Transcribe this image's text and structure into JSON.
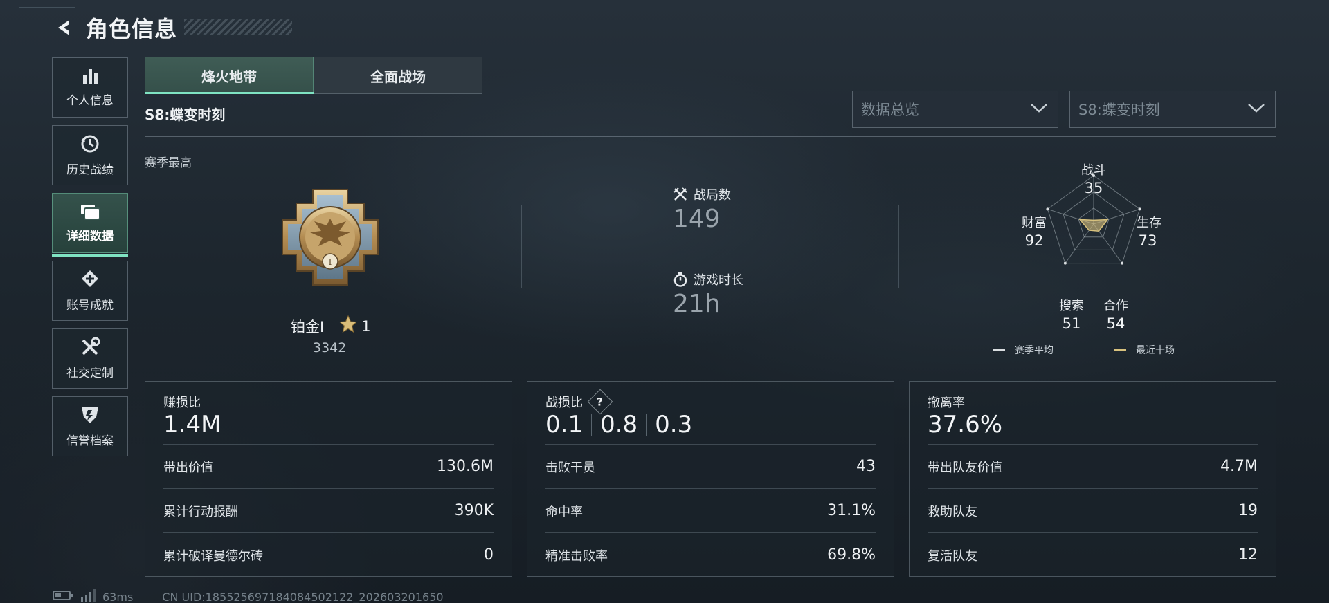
{
  "header": {
    "title": "角色信息"
  },
  "sidebar": {
    "items": [
      {
        "label": "个人信息",
        "icon": "bar-chart-icon"
      },
      {
        "label": "历史战绩",
        "icon": "history-clock-icon"
      },
      {
        "label": "详细数据",
        "icon": "folders-icon",
        "active": true
      },
      {
        "label": "账号成就",
        "icon": "achievement-icon"
      },
      {
        "label": "社交定制",
        "icon": "tools-icon"
      },
      {
        "label": "信誉档案",
        "icon": "credit-shield-icon"
      }
    ]
  },
  "tabs": [
    {
      "label": "烽火地带",
      "active": true
    },
    {
      "label": "全面战场",
      "active": false
    }
  ],
  "season": {
    "label": "S8:蝶变时刻"
  },
  "filters": {
    "category": "数据总览",
    "season": "S8:蝶变时刻"
  },
  "overview": {
    "section_label": "赛季最高",
    "rank_name": "铂金Ⅰ",
    "rank_stars": "1",
    "rank_score": "3342",
    "matches_label": "战局数",
    "matches_value": "149",
    "playtime_label": "游戏时长",
    "playtime_value": "21h"
  },
  "radar": {
    "axes": [
      {
        "label": "战斗",
        "value": "35"
      },
      {
        "label": "生存",
        "value": "73"
      },
      {
        "label": "合作",
        "value": "54"
      },
      {
        "label": "搜索",
        "value": "51"
      },
      {
        "label": "财富",
        "value": "92"
      }
    ],
    "recent_shape": [
      0.08,
      0.3,
      0.18,
      0.16,
      0.3
    ],
    "legend": {
      "season_avg": "赛季平均",
      "recent_ten": "最近十场"
    },
    "colors": {
      "season_avg": "#d9dde0",
      "recent_ten": "#d8c27e"
    }
  },
  "cards": {
    "profit": {
      "title": "赚损比",
      "value": "1.4M",
      "rows": [
        {
          "label": "带出价值",
          "value": "130.6M"
        },
        {
          "label": "累计行动报酬",
          "value": "390K"
        },
        {
          "label": "累计破译曼德尔砖",
          "value": "0"
        }
      ]
    },
    "combat": {
      "title": "战损比",
      "values": [
        "0.1",
        "0.8",
        "0.3"
      ],
      "help": "?",
      "rows": [
        {
          "label": "击败干员",
          "value": "43"
        },
        {
          "label": "命中率",
          "value": "31.1%"
        },
        {
          "label": "精准击败率",
          "value": "69.8%"
        }
      ]
    },
    "extract": {
      "title": "撤离率",
      "value": "37.6%",
      "rows": [
        {
          "label": "带出队友价值",
          "value": "4.7M"
        },
        {
          "label": "救助队友",
          "value": "19"
        },
        {
          "label": "复活队友",
          "value": "12"
        }
      ]
    }
  },
  "status_bar": {
    "ping": "63ms",
    "uid": "CN UID:18552569718408450212​2_202603201650"
  },
  "accent": "#7fe3c2"
}
